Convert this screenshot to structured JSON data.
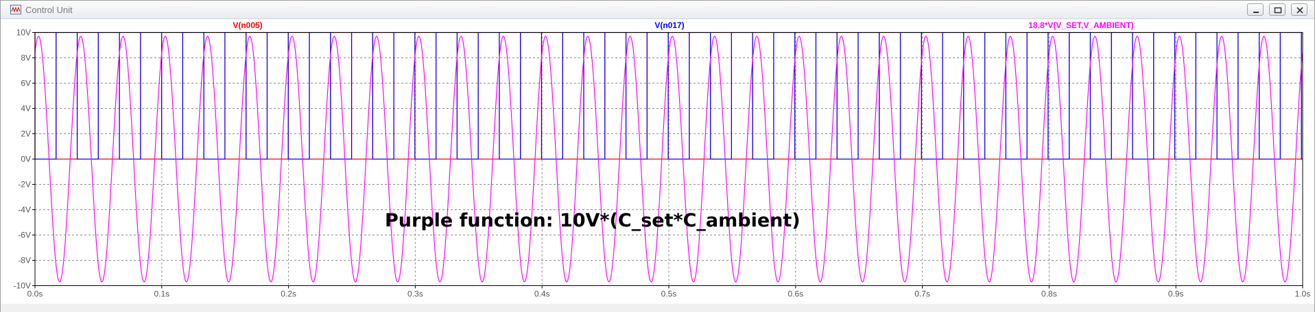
{
  "window": {
    "title": "Control Unit",
    "controls": {
      "minimize": "minimize",
      "maximize": "maximize",
      "close": "close"
    }
  },
  "icons": {
    "app": "waveform-app-icon",
    "minimize": "minimize-icon",
    "maximize": "maximize-icon",
    "close": "close-icon"
  },
  "plot": {
    "annotation": "Purple function: 10V*(C_set*C_ambient)"
  },
  "chart_data": {
    "type": "line",
    "title": "",
    "xlabel": "",
    "ylabel": "",
    "xlim": [
      0.0,
      1.0
    ],
    "ylim": [
      -10,
      10
    ],
    "x_ticks": [
      "0.0s",
      "0.1s",
      "0.2s",
      "0.3s",
      "0.4s",
      "0.5s",
      "0.6s",
      "0.7s",
      "0.8s",
      "0.9s",
      "1.0s"
    ],
    "y_ticks": [
      "10V",
      "8V",
      "6V",
      "4V",
      "2V",
      "0V",
      "-2V",
      "-4V",
      "-6V",
      "-8V",
      "-10V"
    ],
    "grid": true,
    "series": [
      {
        "name": "V(n005)",
        "kind": "pwm_square",
        "color": "#ff0000",
        "low": 0,
        "high": 10,
        "period_s": 0.0333,
        "duty": 0.5,
        "phase_s": 0.0
      },
      {
        "name": "V(n017)",
        "kind": "pwm_square",
        "color": "#0000ff",
        "low": 0,
        "high": 10,
        "period_s": 0.0333,
        "duty": 0.5,
        "phase_s": 0.01665
      },
      {
        "name": "18.8*V(V_SET,V_AMBIENT)",
        "kind": "sine",
        "color": "#ff00ff",
        "amplitude": 9.7,
        "offset": 0,
        "frequency_hz": 30,
        "phase_deg": 60
      }
    ]
  }
}
